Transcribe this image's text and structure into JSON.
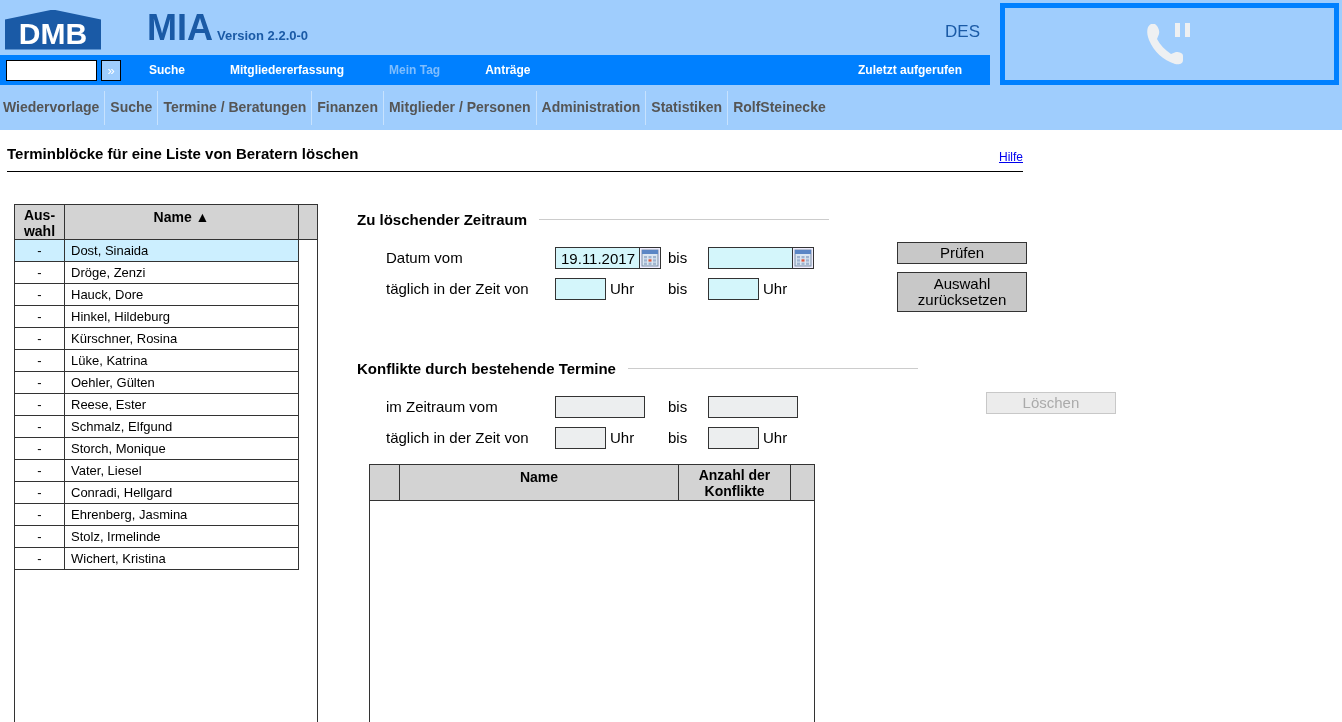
{
  "header": {
    "logo": "DMB",
    "app_name": "MIA",
    "version": "Version 2.2.0-0",
    "user_code": "DES"
  },
  "topbar": {
    "go_label": "»",
    "items": [
      {
        "label": "Suche",
        "disabled": false
      },
      {
        "label": "Mitgliedererfassung",
        "disabled": false
      },
      {
        "label": "Mein Tag",
        "disabled": true
      },
      {
        "label": "Anträge",
        "disabled": false
      }
    ],
    "recent": "Zuletzt aufgerufen"
  },
  "nav": [
    "Wiedervorlage",
    "Suche",
    "Termine / Beratungen",
    "Finanzen",
    "Mitglieder / Personen",
    "Administration",
    "Statistiken",
    "RolfSteinecke"
  ],
  "page": {
    "title": "Terminblöcke für eine Liste von Beratern löschen",
    "help": "Hilfe"
  },
  "advisors": {
    "columns": [
      "Aus-\nwahl",
      "Name ▲"
    ],
    "rows": [
      {
        "pick": "-",
        "name": "Dost, Sinaida",
        "selected": true
      },
      {
        "pick": "-",
        "name": "Dröge, Zenzi",
        "selected": false
      },
      {
        "pick": "-",
        "name": "Hauck, Dore",
        "selected": false
      },
      {
        "pick": "-",
        "name": "Hinkel, Hildeburg",
        "selected": false
      },
      {
        "pick": "-",
        "name": "Kürschner, Rosina",
        "selected": false
      },
      {
        "pick": "-",
        "name": "Lüke, Katrina",
        "selected": false
      },
      {
        "pick": "-",
        "name": "Oehler, Gülten",
        "selected": false
      },
      {
        "pick": "-",
        "name": "Reese, Ester",
        "selected": false
      },
      {
        "pick": "-",
        "name": "Schmalz, Elfgund",
        "selected": false
      },
      {
        "pick": "-",
        "name": "Storch, Monique",
        "selected": false
      },
      {
        "pick": "-",
        "name": "Vater, Liesel",
        "selected": false
      },
      {
        "pick": "-",
        "name": "Conradi, Hellgard",
        "selected": false
      },
      {
        "pick": "-",
        "name": "Ehrenberg, Jasmina",
        "selected": false
      },
      {
        "pick": "-",
        "name": "Stolz, Irmelinde",
        "selected": false
      },
      {
        "pick": "-",
        "name": "Wichert, Kristina",
        "selected": false
      }
    ]
  },
  "period": {
    "heading": "Zu löschender Zeitraum",
    "date_label": "Datum vom",
    "date_from": "19.11.2017",
    "to_label": "bis",
    "time_label": "täglich in der Zeit von",
    "time_to_label": "bis",
    "uhr": "Uhr",
    "uhr2": "Uhr",
    "disabled": false
  },
  "buttons": [
    {
      "label": "Prüfen",
      "disabled": false
    },
    {
      "label": "Auswahl zurücksetzen",
      "disabled": false
    }
  ],
  "conflicts": {
    "heading": "Konflikte durch bestehende Termine",
    "date_label": "im Zeitraum vom",
    "to_label": "bis",
    "time_label": "täglich in der Zeit von",
    "time_to_label": "bis",
    "uhr": "Uhr",
    "uhr2": "Uhr",
    "disabled": true
  },
  "delete_button": {
    "label": "Löschen",
    "disabled": true
  },
  "conflict_table": {
    "columns": [
      "Name",
      "Anzahl der Konflikte"
    ]
  }
}
